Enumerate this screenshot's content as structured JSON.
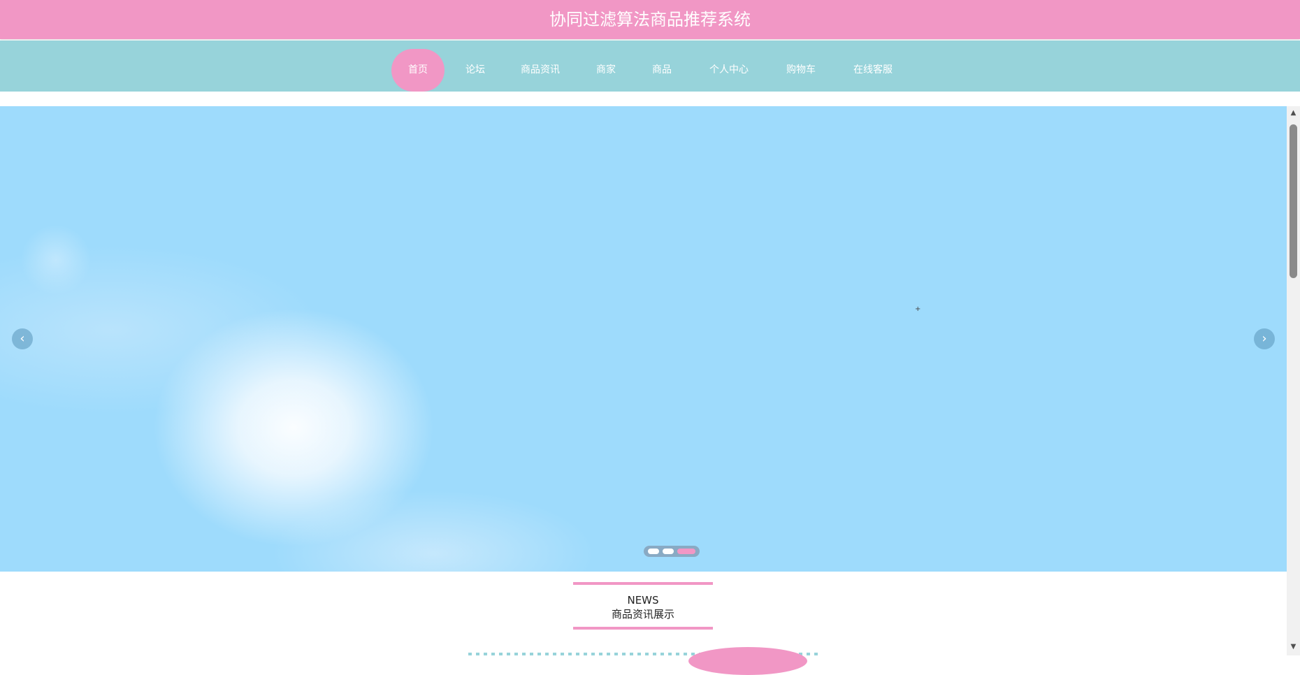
{
  "header": {
    "title": "协同过滤算法商品推荐系统"
  },
  "nav": {
    "items": [
      {
        "label": "首页",
        "active": true
      },
      {
        "label": "论坛"
      },
      {
        "label": "商品资讯"
      },
      {
        "label": "商家"
      },
      {
        "label": "商品"
      },
      {
        "label": "个人中心"
      },
      {
        "label": "购物车"
      },
      {
        "label": "在线客服"
      }
    ]
  },
  "carousel": {
    "prev_icon": "chevron-left-icon",
    "next_icon": "chevron-right-icon",
    "slide_count": 3,
    "active_slide": 3
  },
  "news_section": {
    "label_en": "NEWS",
    "label_cn": "商品资讯展示"
  },
  "colors": {
    "header_bg": "#f197c5",
    "nav_bg": "#97d3da",
    "accent": "#f197c5",
    "banner_sky": "#9edbfc"
  }
}
